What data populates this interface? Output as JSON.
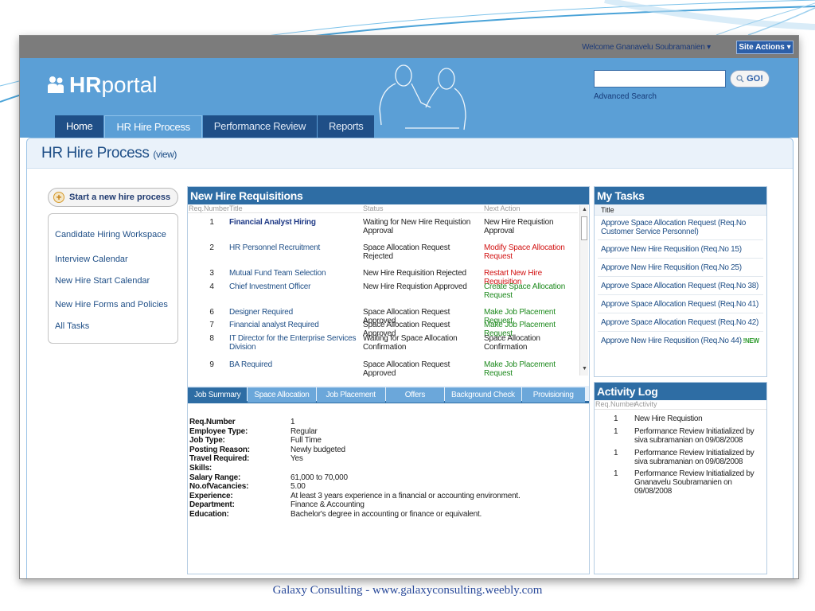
{
  "header": {
    "welcome": "Welcome Gnanavelu Soubramanien",
    "site_actions": "Site Actions",
    "logo_bold": "HR",
    "logo_light": "portal",
    "search_placeholder": "",
    "go_label": "GO!",
    "advanced_search": "Advanced Search"
  },
  "tabs": [
    {
      "label": "Home"
    },
    {
      "label": "HR Hire Process"
    },
    {
      "label": "Performance Review"
    },
    {
      "label": "Reports"
    }
  ],
  "page": {
    "title": "HR Hire Process",
    "title_suffix": "(view)"
  },
  "left": {
    "start_button": "Start a new hire process",
    "nav": [
      "Candidate Hiring Workspace",
      "Interview Calendar",
      "New Hire Start Calendar",
      "New Hire Forms and Policies",
      "All Tasks"
    ]
  },
  "requisitions": {
    "heading": "New Hire Requisitions",
    "columns": [
      "Req.Number",
      "Title",
      "Status",
      "Next Action"
    ],
    "rows": [
      {
        "num": "1",
        "title": "Financial Analyst Hiring",
        "status": "Waiting for New Hire Requistion Approval",
        "action": "New Hire Requistion Approval",
        "action_color": "black"
      },
      {
        "num": "2",
        "title": "HR Personnel Recruitment",
        "status": "Space Allocation Request Rejected",
        "action": "Modify Space Allocation Request",
        "action_color": "red"
      },
      {
        "num": "3",
        "title": "Mutual Fund Team Selection",
        "status": "New Hire Requisition Rejected",
        "action": "Restart New Hire Requisition",
        "action_color": "red"
      },
      {
        "num": "4",
        "title": "Chief Investment Officer",
        "status": "New Hire Requistion Approved",
        "action": "Create Space Allocation Request",
        "action_color": "green"
      },
      {
        "num": "6",
        "title": "Designer Required",
        "status": "Space Allocation Request Approved",
        "action": "Make Job Placement Request",
        "action_color": "green"
      },
      {
        "num": "7",
        "title": "Financial analyst Required",
        "status": "Space Allocation Request Approved",
        "action": "Make Job Placement Request",
        "action_color": "green"
      },
      {
        "num": "8",
        "title": "IT Director for the Enterprise Services Division",
        "status": "Waiting for Space Allocation Confirmation",
        "action": "Space Allocation Confirmation",
        "action_color": "black"
      },
      {
        "num": "9",
        "title": "BA Required",
        "status": "Space Allocation Request Approved",
        "action": "Make Job Placement Request",
        "action_color": "green"
      }
    ]
  },
  "subtabs": [
    "Job Summary",
    "Space Allocation",
    "Job Placement",
    "Offers",
    "Background Check",
    "Provisioning"
  ],
  "details": [
    {
      "label": "Req.Number",
      "value": "1"
    },
    {
      "label": "Employee Type:",
      "value": "Regular"
    },
    {
      "label": "Job Type:",
      "value": "Full Time"
    },
    {
      "label": "Posting Reason:",
      "value": "Newly budgeted"
    },
    {
      "label": "Travel Required:",
      "value": "Yes"
    },
    {
      "label": "Skills:",
      "value": ""
    },
    {
      "label": "Salary Range:",
      "value": "61,000 to 70,000"
    },
    {
      "label": "No.ofVacancies:",
      "value": "5.00"
    },
    {
      "label": "Experience:",
      "value": "At least 3 years experience in a financial or accounting environment."
    },
    {
      "label": "Department:",
      "value": "Finance & Accounting"
    },
    {
      "label": "Education:",
      "value": "Bachelor's degree in accounting or finance or equivalent."
    }
  ],
  "tasks": {
    "heading": "My Tasks",
    "column": "Title",
    "items": [
      "Approve Space Allocation Request (Req.No Customer Service Personnel)",
      "Approve New Hire Requsition (Req.No 15)",
      "Approve New Hire Requsition (Req.No 25)",
      "Approve Space Allocation Request (Req.No 38)",
      "Approve Space Allocation Request (Req.No 41)",
      "Approve Space Allocation Request (Req.No 42)",
      "Approve New Hire Requsition (Req.No 44)"
    ],
    "new_badge": "NEW"
  },
  "log": {
    "heading": "Activity Log",
    "columns": [
      "Req.Number",
      "Activity"
    ],
    "rows": [
      {
        "num": "1",
        "activity": "New Hire Requistion"
      },
      {
        "num": "1",
        "activity": "Performance Review Initiatialized by siva subramanian on 09/08/2008"
      },
      {
        "num": "1",
        "activity": "Performance Review Initiatialized by siva subramanian on 09/08/2008"
      },
      {
        "num": "1",
        "activity": "Performance Review Initiatialized by Gnanavelu Soubramanien on 09/08/2008"
      }
    ]
  },
  "footer": "Galaxy Consulting - www.galaxyconsulting.weebly.com"
}
